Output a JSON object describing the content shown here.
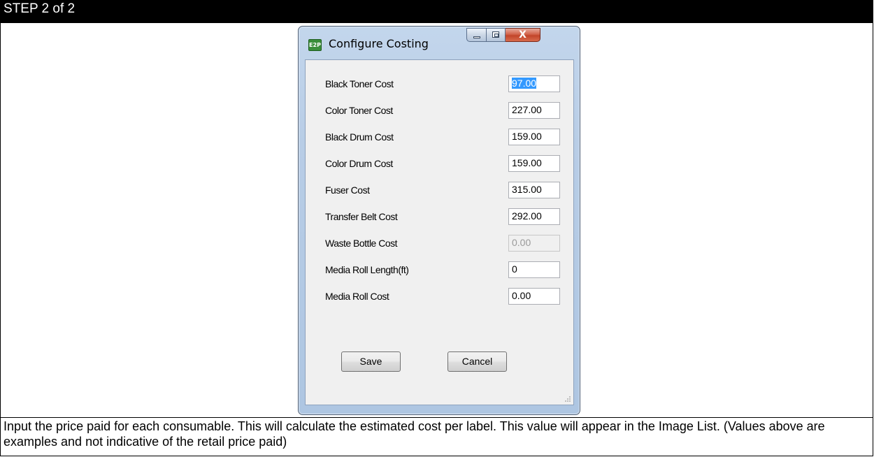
{
  "header": {
    "step": "STEP 2 of 2"
  },
  "window": {
    "icon_text": "E2P",
    "title": "Configure Costing",
    "close_glyph": "X"
  },
  "fields": [
    {
      "label": "Black Toner Cost",
      "value": "97.00",
      "state": "selected"
    },
    {
      "label": "Color Toner Cost",
      "value": "227.00",
      "state": "normal"
    },
    {
      "label": "Black Drum Cost",
      "value": "159.00",
      "state": "normal"
    },
    {
      "label": "Color Drum Cost",
      "value": "159.00",
      "state": "normal"
    },
    {
      "label": "Fuser Cost",
      "value": "315.00",
      "state": "normal"
    },
    {
      "label": "Transfer Belt Cost",
      "value": "292.00",
      "state": "normal"
    },
    {
      "label": "Waste Bottle Cost",
      "value": "0.00",
      "state": "disabled"
    },
    {
      "label": "Media Roll Length(ft)",
      "value": "0",
      "state": "normal"
    },
    {
      "label": "Media Roll Cost",
      "value": "0.00",
      "state": "normal"
    }
  ],
  "buttons": {
    "save": "Save",
    "cancel": "Cancel"
  },
  "caption": "Input the price paid for each consumable. This will calculate the estimated cost per label. This value will appear in the Image List. (Values above are examples and not indicative of the retail price paid)"
}
